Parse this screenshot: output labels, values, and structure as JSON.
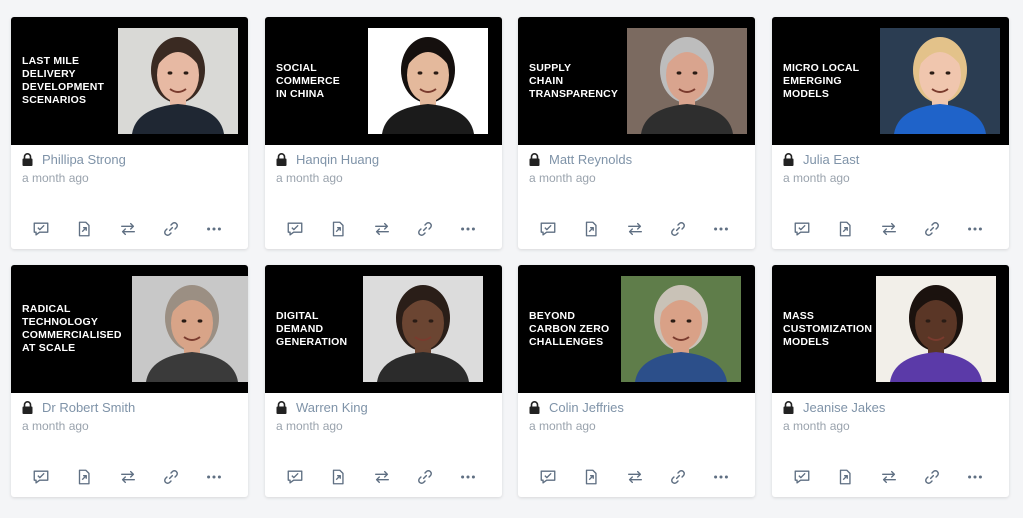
{
  "cards": [
    {
      "title": "LAST MILE\nDELIVERY\nDEVELOPMENT\nSCENARIOS",
      "author": "Phillipa Strong",
      "time": "a month ago",
      "photo_bg": "#d9d9d6",
      "skin": "#e7b9a3",
      "hair": "#3a2a22",
      "shirt": "#1f2733"
    },
    {
      "title": "SOCIAL\nCOMMERCE\nIN CHINA",
      "author": "Hanqin Huang",
      "time": "a month ago",
      "photo_bg": "#ffffff",
      "skin": "#e4b99c",
      "hair": "#15100e",
      "shirt": "#1b1b1b"
    },
    {
      "title": "SUPPLY\nCHAIN\nTRANSPARENCY",
      "author": "Matt Reynolds",
      "time": "a month ago",
      "photo_bg": "#7b6a60",
      "skin": "#d9a48e",
      "hair": "#bdbdbd",
      "shirt": "#2e2e2e"
    },
    {
      "title": "MICRO LOCAL\nEMERGING\nMODELS",
      "author": "Julia East",
      "time": "a month ago",
      "photo_bg": "#2b3d52",
      "skin": "#f0c6ae",
      "hair": "#e3c28a",
      "shirt": "#1f63c9"
    },
    {
      "title": "RADICAL\nTECHNOLOGY\nCOMMERCIALISED\nAT SCALE",
      "author": "Dr Robert Smith",
      "time": "a month ago",
      "photo_bg": "#c8c8c8",
      "skin": "#d8a488",
      "hair": "#9b8f83",
      "shirt": "#3a3a3a"
    },
    {
      "title": "DIGITAL\nDEMAND\nGENERATION",
      "author": "Warren King",
      "time": "a month ago",
      "photo_bg": "#dcdcdc",
      "skin": "#6b4532",
      "hair": "#2a1e18",
      "shirt": "#2b2b2b"
    },
    {
      "title": "BEYOND\nCARBON ZERO\nCHALLENGES",
      "author": "Colin Jeffries",
      "time": "a month ago",
      "photo_bg": "#5f7d4a",
      "skin": "#d9a187",
      "hair": "#c9c2b7",
      "shirt": "#2c4f8a"
    },
    {
      "title": "MASS\nCUSTOMIZATION\nMODELS",
      "author": "Jeanise Jakes",
      "time": "a month ago",
      "photo_bg": "#f2efe9",
      "skin": "#5a3626",
      "hair": "#1b120e",
      "shirt": "#5b3aa8"
    }
  ],
  "icons": {
    "lock": "lock-icon",
    "actions": [
      "comment-check-icon",
      "share-icon",
      "swap-icon",
      "link-icon",
      "more-icon"
    ]
  },
  "colors": {
    "author": "#7f93a8",
    "time": "#9aa3ad",
    "icon": "#5f6f82",
    "thumb_bg": "#000000"
  }
}
